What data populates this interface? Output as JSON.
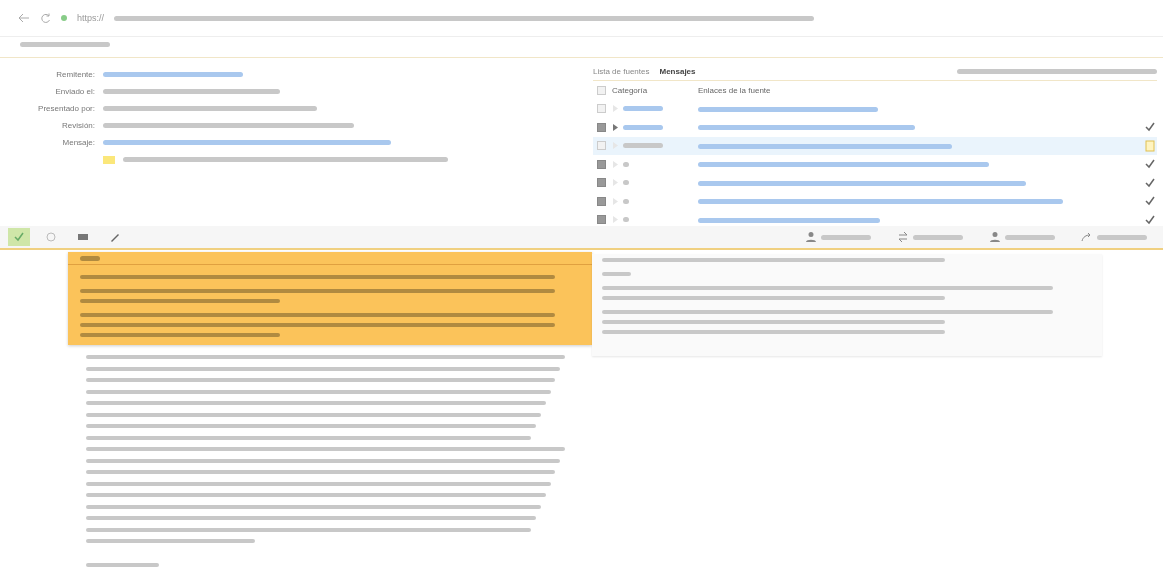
{
  "browser": {
    "url_scheme": "https://"
  },
  "header": {
    "fields": [
      {
        "label": "Remitente:",
        "kind": "link"
      },
      {
        "label": "Enviado el:",
        "kind": "plain"
      },
      {
        "label": "Presentado por:",
        "kind": "plain"
      },
      {
        "label": "Revisión:",
        "kind": "plain"
      },
      {
        "label": "Mensaje:",
        "kind": "link"
      },
      {
        "kind": "flagged"
      }
    ]
  },
  "sources": {
    "tabs": [
      {
        "label": "Lista de fuentes",
        "selected": false
      },
      {
        "label": "Mensajes",
        "selected": true
      }
    ],
    "all_checked": false,
    "columns": [
      "Categoría",
      "Enlaces de la fuente"
    ],
    "rows": [
      {
        "checked": false,
        "expanded": false,
        "selected": false,
        "kind": "none"
      },
      {
        "checked": true,
        "expanded": true,
        "selected": false,
        "kind": "check"
      },
      {
        "checked": false,
        "expanded": false,
        "selected": true,
        "kind": "flag"
      },
      {
        "checked": true,
        "expanded": false,
        "selected": false,
        "kind": "check"
      },
      {
        "checked": true,
        "expanded": false,
        "selected": false,
        "kind": "check"
      },
      {
        "checked": true,
        "expanded": false,
        "selected": false,
        "kind": "check"
      },
      {
        "checked": true,
        "expanded": false,
        "selected": false,
        "kind": "check"
      }
    ]
  },
  "toolbar": {
    "tools": [
      {
        "kind": "check",
        "selected": true
      },
      {
        "kind": "info",
        "selected": false
      },
      {
        "kind": "grid",
        "selected": false
      },
      {
        "kind": "pen",
        "selected": false
      }
    ],
    "actions": [
      {
        "kind": "person"
      },
      {
        "kind": "swap"
      },
      {
        "kind": "person"
      },
      {
        "kind": "share"
      }
    ]
  }
}
